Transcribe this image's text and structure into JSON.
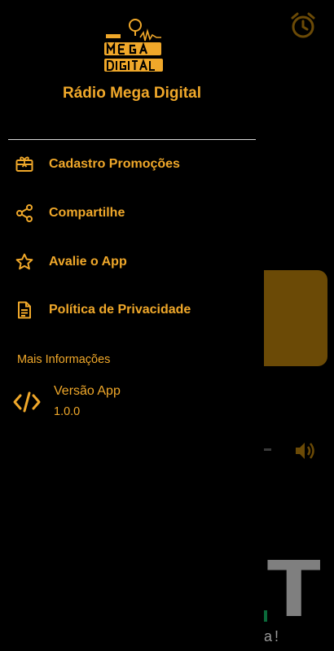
{
  "background": {
    "alarm_icon": "alarm-clock-icon",
    "volume_icon": "volume-icon",
    "logo_glyph": "T",
    "tagline": "a!"
  },
  "drawer": {
    "logo_icon": "radio-mega-digital-logo",
    "title": "Rádio Mega Digital",
    "menu": [
      {
        "label": "Cadastro Promoções",
        "icon": "gift-card-icon"
      },
      {
        "label": "Compartilhe",
        "icon": "share-icon"
      },
      {
        "label": "Avalie o App",
        "icon": "star-outline-icon"
      },
      {
        "label": "Política de Privacidade",
        "icon": "document-icon"
      }
    ],
    "section_title": "Mais Informações",
    "version": {
      "label": "Versão App",
      "value": "1.0.0",
      "icon": "code-icon"
    }
  },
  "colors": {
    "accent": "#f0a82a",
    "background": "#000000",
    "divider": "#d9d9d9"
  }
}
